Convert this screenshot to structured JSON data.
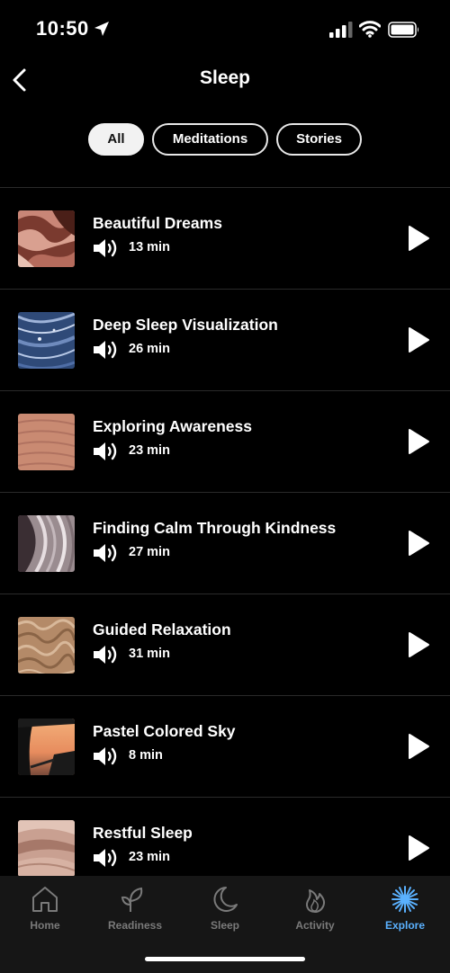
{
  "status_bar": {
    "time": "10:50"
  },
  "header": {
    "title": "Sleep"
  },
  "filters": [
    {
      "label": "All",
      "active": true
    },
    {
      "label": "Meditations",
      "active": false
    },
    {
      "label": "Stories",
      "active": false
    }
  ],
  "sessions": [
    {
      "title": "Beautiful Dreams",
      "duration": "13 min",
      "thumb": "red-canyon"
    },
    {
      "title": "Deep Sleep Visualization",
      "duration": "26 min",
      "thumb": "blue-agate"
    },
    {
      "title": "Exploring Awareness",
      "duration": "23 min",
      "thumb": "sand-ripples"
    },
    {
      "title": "Finding Calm Through Kindness",
      "duration": "27 min",
      "thumb": "grey-agate"
    },
    {
      "title": "Guided Relaxation",
      "duration": "31 min",
      "thumb": "sand-texture"
    },
    {
      "title": "Pastel Colored Sky",
      "duration": "8 min",
      "thumb": "sunset-car"
    },
    {
      "title": "Restful Sleep",
      "duration": "23 min",
      "thumb": "dunes"
    }
  ],
  "tab_bar": {
    "tabs": [
      {
        "label": "Home",
        "icon": "home-icon"
      },
      {
        "label": "Readiness",
        "icon": "sprout-icon"
      },
      {
        "label": "Sleep",
        "icon": "moon-icon"
      },
      {
        "label": "Activity",
        "icon": "flame-icon"
      },
      {
        "label": "Explore",
        "icon": "sparkle-icon",
        "active": true
      }
    ],
    "active_color": "#5ab1ff",
    "inactive_color": "#7a7a7a"
  }
}
